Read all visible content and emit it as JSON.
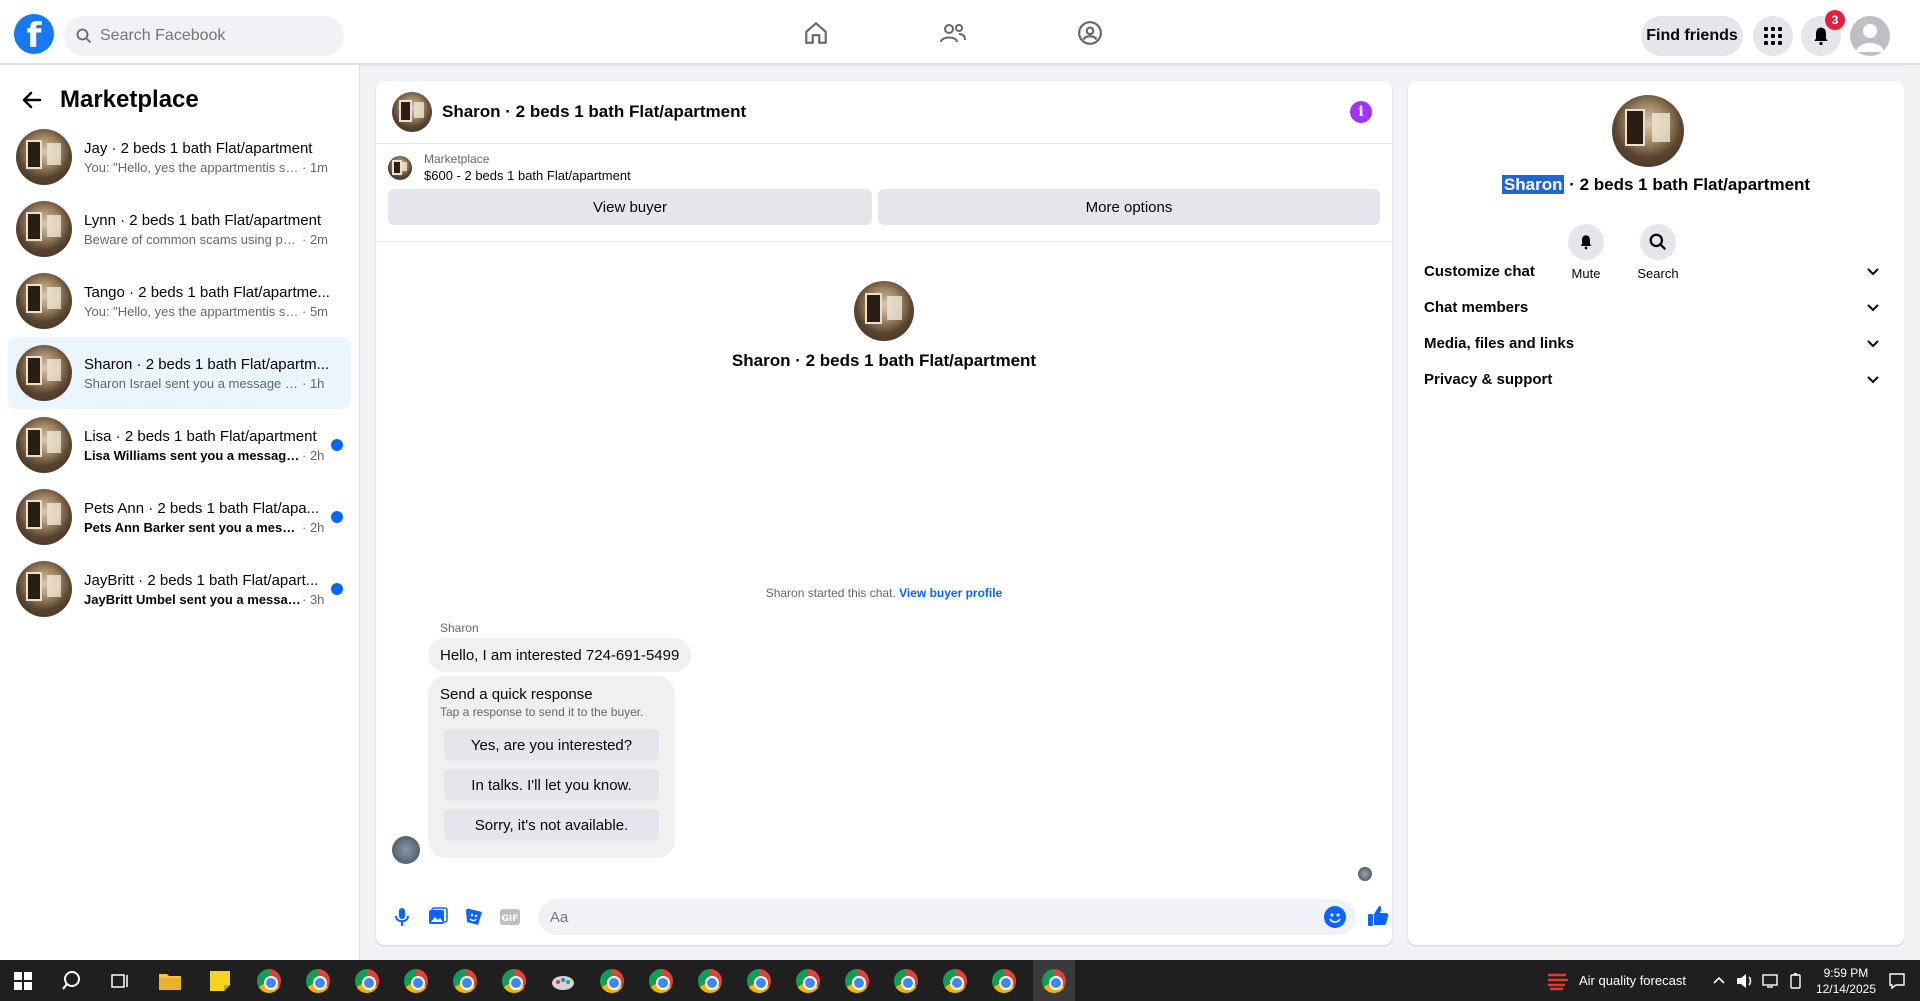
{
  "topbar": {
    "search_placeholder": "Search Facebook",
    "find_friends": "Find friends",
    "notification_count": "3"
  },
  "sidebar": {
    "title": "Marketplace",
    "conversations": [
      {
        "title": "Jay · 2 beds 1 bath Flat/apartment",
        "snippet": "You: \"Hello, yes the appartmentis still...",
        "time": "· 1m",
        "unread": false,
        "active": false
      },
      {
        "title": "Lynn · 2 beds 1 bath Flat/apartment",
        "snippet": "Beware of common scams using pay...",
        "time": "· 2m",
        "unread": false,
        "active": false
      },
      {
        "title": "Tango · 2 beds 1 bath Flat/apartme...",
        "snippet": "You: \"Hello, yes the appartmentis still...",
        "time": "· 5m",
        "unread": false,
        "active": false
      },
      {
        "title": "Sharon · 2 beds 1 bath Flat/apartm...",
        "snippet": "Sharon Israel sent you a message abo...",
        "time": "· 1h",
        "unread": false,
        "active": true
      },
      {
        "title": "Lisa · 2 beds 1 bath Flat/apartment",
        "snippet": "Lisa Williams sent you a message a...",
        "time": "· 2h",
        "unread": true,
        "active": false
      },
      {
        "title": "Pets Ann · 2 beds 1 bath Flat/apa...",
        "snippet": "Pets Ann Barker sent you a messag...",
        "time": "· 2h",
        "unread": true,
        "active": false
      },
      {
        "title": "JayBritt · 2 beds 1 bath Flat/apart...",
        "snippet": "JayBritt Umbel sent you a message...",
        "time": "· 3h",
        "unread": true,
        "active": false
      }
    ]
  },
  "chat": {
    "header_name": "Sharon · 2 beds 1 bath Flat/apartment",
    "marketplace_label": "Marketplace",
    "listing": "$600 - 2 beds 1 bath Flat/apartment",
    "view_buyer": "View buyer",
    "more_options": "More options",
    "center_name": "Sharon · 2 beds 1 bath Flat/apartment",
    "started_text": "Sharon started this chat.",
    "view_buyer_profile": "View buyer profile",
    "sender": "Sharon",
    "message": "Hello, I am interested 724-691-5499",
    "quick_title": "Send a quick response",
    "quick_sub": "Tap a response to send it to the buyer.",
    "quick_options": [
      "Yes, are you interested?",
      "In talks. I'll let you know.",
      "Sorry, it's not available."
    ],
    "composer_placeholder": "Aa"
  },
  "info": {
    "name_highlight": "Sharon",
    "name_rest": " · 2 beds 1 bath Flat/apartment",
    "mute": "Mute",
    "search": "Search",
    "sections": [
      "Customize chat",
      "Chat members",
      "Media, files and links",
      "Privacy & support"
    ]
  },
  "taskbar": {
    "weather": "Air quality forecast",
    "time": "9:59 PM",
    "date": "12/14/2025"
  },
  "colors": {
    "facebook_blue": "#1877f2",
    "messenger_blue": "#0866ff",
    "active_conv_bg": "#ebf5ff",
    "notification_red": "#e41e3f"
  }
}
